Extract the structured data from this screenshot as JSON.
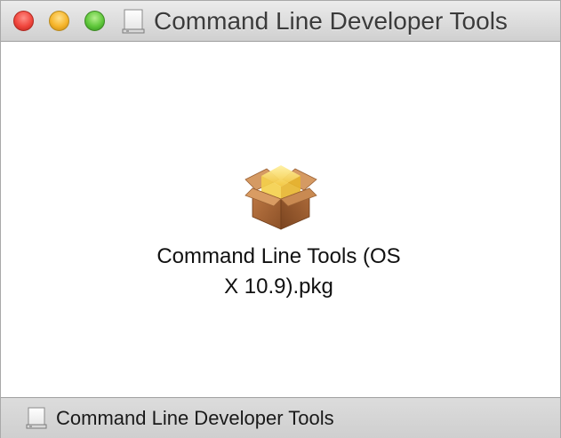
{
  "window": {
    "title": "Command Line Developer Tools",
    "title_icon": "disk-image-icon",
    "controls": {
      "close": "close-button",
      "minimize": "minimize-button",
      "zoom": "zoom-button"
    }
  },
  "content": {
    "items": [
      {
        "icon": "package-icon",
        "name_line1": "Command Line Tools (OS",
        "name_line2": "X 10.9).pkg"
      }
    ]
  },
  "statusbar": {
    "icon": "disk-image-icon",
    "path_label": "Command Line Developer Tools"
  },
  "colors": {
    "close": "#f0463d",
    "minimize": "#f6b52b",
    "zoom": "#5fc73a",
    "package_box": "#a8683a",
    "package_yellow": "#f7d24a"
  }
}
